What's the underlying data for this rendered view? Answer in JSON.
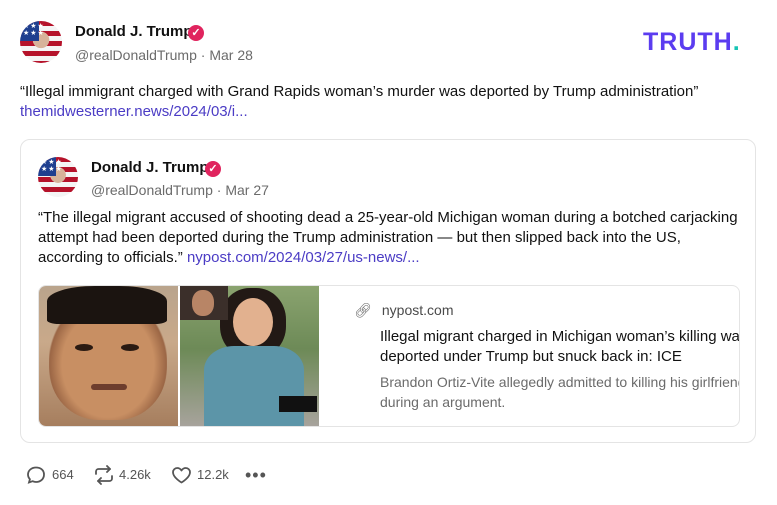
{
  "logo": {
    "text": "TRUTH",
    "dot": "."
  },
  "post": {
    "author": {
      "name": "Donald J. Trump",
      "handle": "@realDonaldTrump",
      "date": "Mar 28"
    },
    "text": "“Illegal immigrant charged with Grand Rapids woman’s murder was deported by Trump administration”",
    "link": "themidwesterner.news/2024/03/i..."
  },
  "quote": {
    "author": {
      "name": "Donald J. Trump",
      "handle": "@realDonaldTrump",
      "date": "Mar 27"
    },
    "text": "“The illegal migrant accused of shooting dead a 25-year-old Michigan woman during a botched carjacking attempt had been deported during the Trump administration — but then slipped back into the US, according to officials.”",
    "link": "nypost.com/2024/03/27/us-news/...",
    "card": {
      "domain": "nypost.com",
      "title": "Illegal migrant charged in Michigan woman’s killing was deported under Trump but snuck back in: ICE",
      "description": "Brandon Ortiz-Vite allegedly admitted to killing his girlfriend during an argument."
    }
  },
  "actions": {
    "replies": "664",
    "reposts": "4.26k",
    "likes": "12.2k"
  },
  "colors": {
    "accent": "#5b3cf0",
    "link": "#4b3cc5",
    "verified": "#e0245e"
  },
  "icons": [
    "verified-icon",
    "link-icon",
    "reply-icon",
    "repost-icon",
    "like-icon",
    "more-icon"
  ]
}
